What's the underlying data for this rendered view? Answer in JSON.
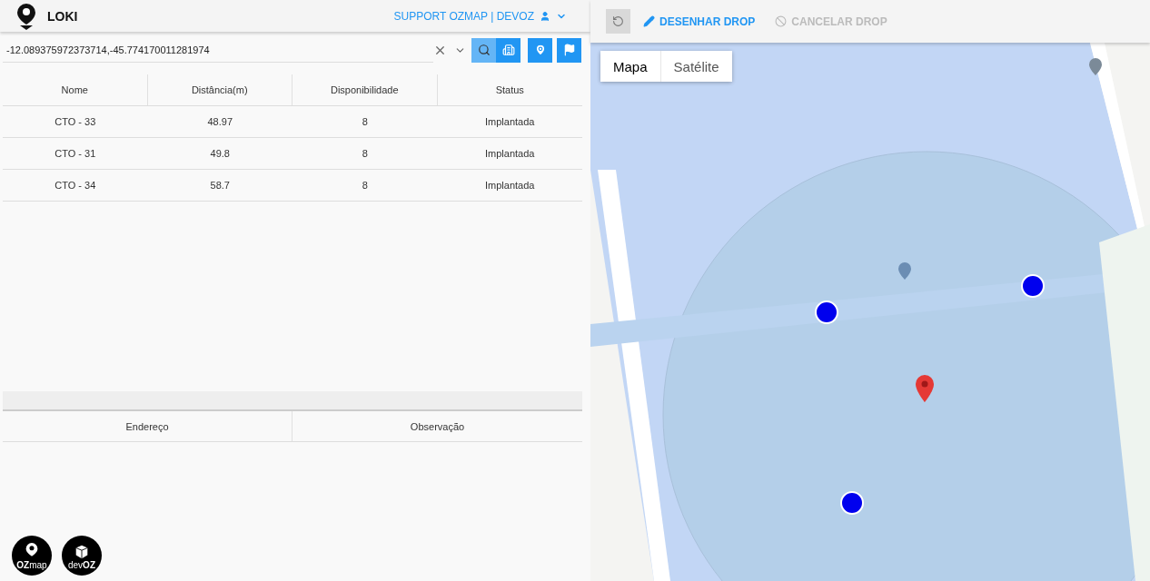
{
  "header": {
    "title": "LOKI",
    "user": "SUPPORT OZMAP | DEVOZ"
  },
  "search": {
    "value": "-12.089375972373714,-45.774170011281974"
  },
  "table": {
    "columns": [
      "Nome",
      "Distância(m)",
      "Disponibilidade",
      "Status"
    ],
    "rows": [
      [
        "CTO - 33",
        "48.97",
        "8",
        "Implantada"
      ],
      [
        "CTO - 31",
        "49.8",
        "8",
        "Implantada"
      ],
      [
        "CTO - 34",
        "58.7",
        "8",
        "Implantada"
      ]
    ]
  },
  "details_table": {
    "columns": [
      "Endereço",
      "Observação"
    ]
  },
  "footer_logos": [
    "**OZ**map",
    "dev**OZ**"
  ],
  "map_toolbar": {
    "undo_disabled": true,
    "buttons": [
      {
        "label": "DESENHAR DROP",
        "kind": "draw",
        "disabled": false
      },
      {
        "label": "CANCELAR DROP",
        "kind": "cancel",
        "disabled": true
      }
    ]
  },
  "map": {
    "map_types": [
      {
        "label": "Mapa",
        "selected": true
      },
      {
        "label": "Satélite",
        "selected": false
      }
    ]
  }
}
